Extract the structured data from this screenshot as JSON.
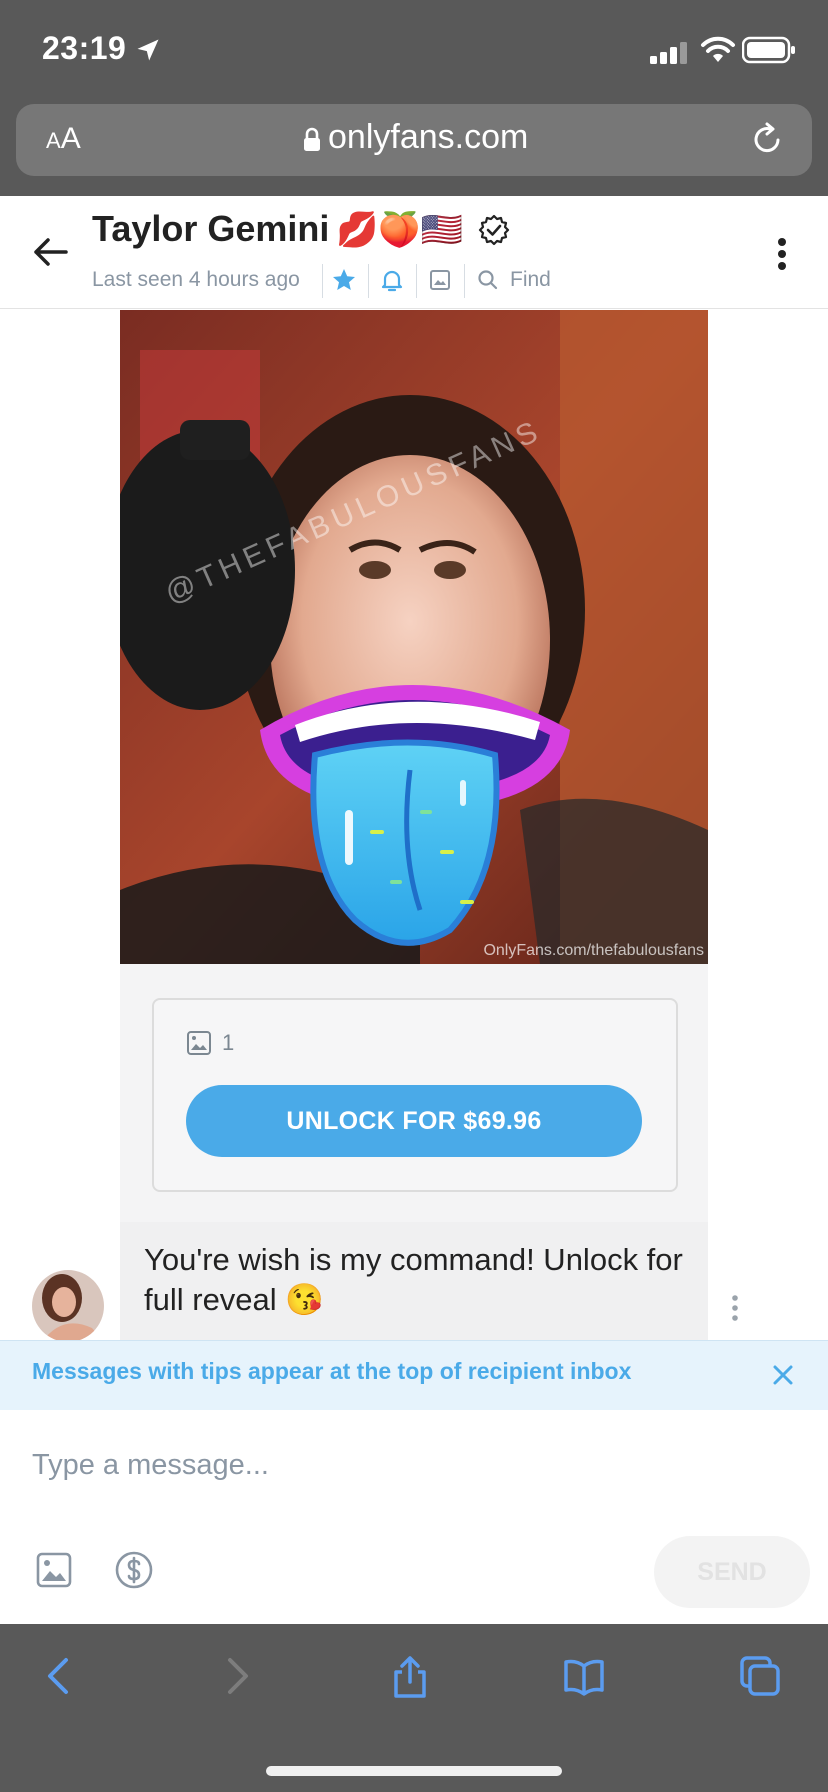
{
  "status_bar": {
    "time": "23:19"
  },
  "browser": {
    "aa_small": "A",
    "aa_large": "A",
    "url": "onlyfans.com"
  },
  "chat": {
    "name": "Taylor Gemini",
    "name_emojis": "💋🍑🇺🇸",
    "last_seen": "Last seen 4 hours ago",
    "find_label": "Find"
  },
  "photo": {
    "watermark_diagonal": "@THEFABULOUSFANS",
    "watermark_footer": "OnlyFans.com/thefabulousfans"
  },
  "locked_media": {
    "media_count": "1",
    "unlock_label": "UNLOCK FOR $69.96"
  },
  "message": {
    "text": "You're wish is my command! Unlock for full reveal 😘"
  },
  "tips_banner": {
    "text": "Messages with tips appear at the top of recipient inbox"
  },
  "composer": {
    "placeholder": "Type a message...",
    "send_label": "SEND"
  },
  "colors": {
    "accent": "#4aaae8",
    "browser_chrome": "#595959",
    "banner_bg": "#e6f3fc"
  },
  "icons": [
    "location-arrow-icon",
    "signal-icon",
    "wifi-icon",
    "battery-icon",
    "lock-icon",
    "reload-icon",
    "back-arrow-icon",
    "verified-icon",
    "star-icon",
    "bell-icon",
    "image-icon",
    "search-icon",
    "more-vertical-icon",
    "close-icon",
    "attach-image-icon",
    "tip-dollar-icon",
    "back-chevron-icon",
    "forward-chevron-icon",
    "share-icon",
    "bookmarks-icon",
    "tabs-icon"
  ]
}
